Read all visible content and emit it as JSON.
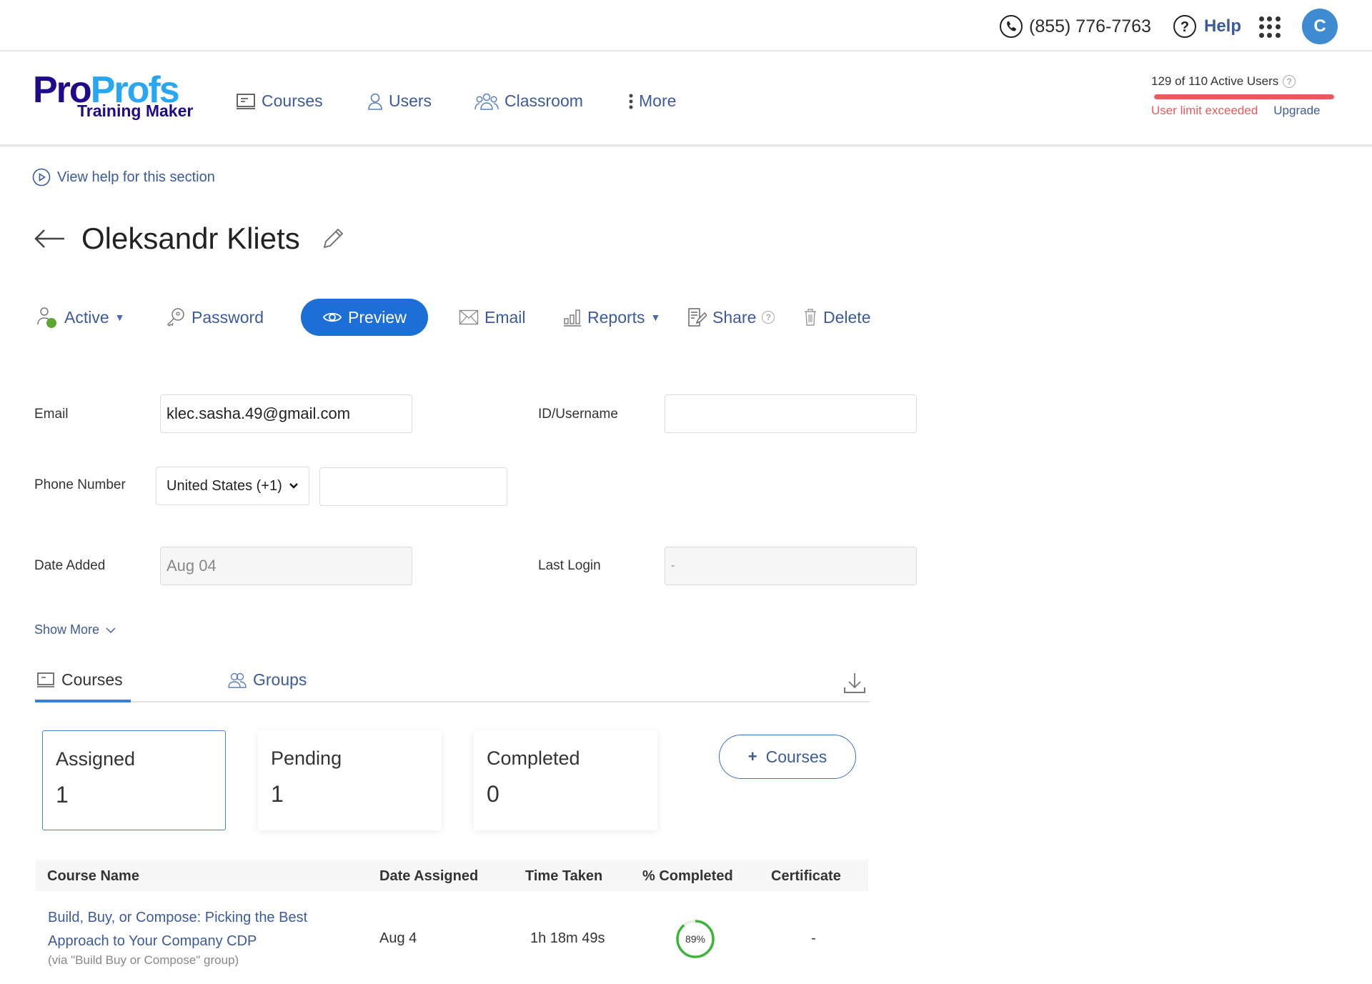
{
  "topbar": {
    "phone": "(855) 776-7763",
    "help_label": "Help",
    "avatar_initial": "C"
  },
  "header": {
    "logo": {
      "brand_part1": "Pro",
      "brand_part2": "Profs",
      "subtitle": "Training Maker"
    },
    "nav": [
      {
        "label": "Courses",
        "icon": "course-icon"
      },
      {
        "label": "Users",
        "icon": "user-icon"
      },
      {
        "label": "Classroom",
        "icon": "classroom-icon"
      },
      {
        "label": "More",
        "icon": "kebab-icon"
      }
    ],
    "quota": {
      "text": "129 of 110 Active Users",
      "active": 129,
      "limit": 110,
      "fill_percent": 100,
      "warning": "User limit exceeded",
      "upgrade_label": "Upgrade",
      "bar_color": "#e85a5e"
    }
  },
  "help_link": "View help for this section",
  "user": {
    "name": "Oleksandr Kliets",
    "status": "Active",
    "status_color": "#5aa832"
  },
  "actions": {
    "active": "Active",
    "password": "Password",
    "preview": "Preview",
    "email": "Email",
    "reports": "Reports",
    "share": "Share",
    "delete": "Delete"
  },
  "form": {
    "email_label": "Email",
    "email_value": "klec.sasha.49@gmail.com",
    "id_label": "ID/Username",
    "id_value": "",
    "phone_label": "Phone Number",
    "country_selected": "United States (+1)",
    "phone_value": "",
    "date_added_label": "Date Added",
    "date_added_value": "Aug 04",
    "last_login_label": "Last Login",
    "last_login_value": "-"
  },
  "show_more": "Show More",
  "tabs": [
    {
      "label": "Courses",
      "active": true
    },
    {
      "label": "Groups",
      "active": false
    }
  ],
  "stats": [
    {
      "title": "Assigned",
      "value": "1",
      "selected": true
    },
    {
      "title": "Pending",
      "value": "1",
      "selected": false
    },
    {
      "title": "Completed",
      "value": "0",
      "selected": false
    }
  ],
  "add_courses_label": "Courses",
  "table": {
    "headers": [
      "Course Name",
      "Date Assigned",
      "Time Taken",
      "% Completed",
      "Certificate"
    ],
    "rows": [
      {
        "course_name": "Build, Buy, or Compose: Picking the Best Approach to Your Company CDP",
        "via": "(via \"Build Buy or Compose\" group)",
        "date_assigned": "Aug 4",
        "time_taken": "1h 18m 49s",
        "percent_completed": 89,
        "percent_label": "89%",
        "certificate": "-"
      }
    ]
  },
  "colors": {
    "accent": "#1c6fd6",
    "link": "#3d5a99",
    "danger": "#e85a5e",
    "progress": "#3db33a"
  }
}
